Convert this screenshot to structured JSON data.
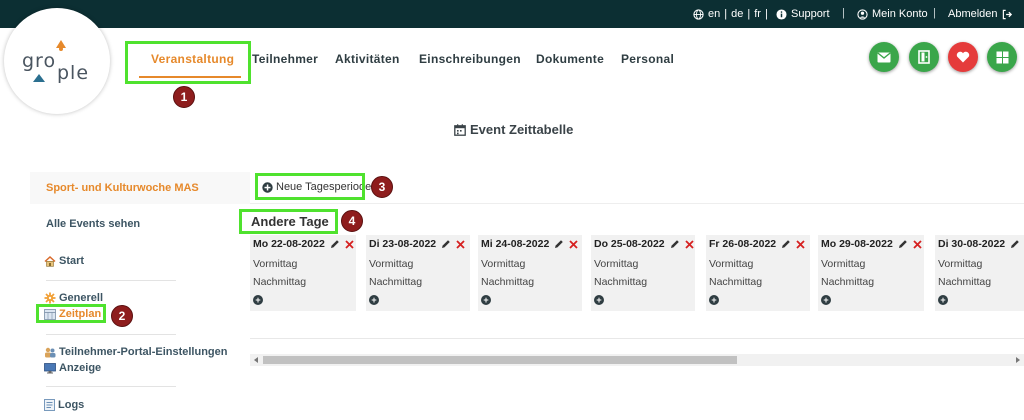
{
  "topbar": {
    "lang_en": "en",
    "lang_de": "de",
    "lang_fr": "fr",
    "support": "Support",
    "account": "Mein Konto",
    "logout": "Abmelden"
  },
  "logo": {
    "text1": "gro",
    "text2": "ple"
  },
  "nav": {
    "items": [
      "Veranstaltung",
      "Teilnehmer",
      "Aktivitäten",
      "Einschreibungen",
      "Dokumente",
      "Personal"
    ]
  },
  "actions": {
    "mail_color": "#3aa64a",
    "door_color": "#3aa64a",
    "heart_color": "#e53b3b",
    "grid_color": "#3aa64a"
  },
  "page": {
    "title": "Event Zeittabelle"
  },
  "sidebar": {
    "event_name": "Sport- und Kulturwoche MAS",
    "all_events": "Alle Events sehen",
    "start": "Start",
    "generell": "Generell",
    "zeitplan": "Zeitplan",
    "portal": "Teilnehmer-Portal-Einstellungen",
    "anzeige": "Anzeige",
    "logs": "Logs"
  },
  "timetable": {
    "add_period": "Neue Tagesperiode",
    "section": "Andere Tage",
    "days": [
      {
        "label": "Mo 22-08-2022",
        "slots": [
          "Vormittag",
          "Nachmittag"
        ]
      },
      {
        "label": "Di 23-08-2022",
        "slots": [
          "Vormittag",
          "Nachmittag"
        ]
      },
      {
        "label": "Mi 24-08-2022",
        "slots": [
          "Vormittag",
          "Nachmittag"
        ]
      },
      {
        "label": "Do 25-08-2022",
        "slots": [
          "Vormittag",
          "Nachmittag"
        ]
      },
      {
        "label": "Fr 26-08-2022",
        "slots": [
          "Vormittag",
          "Nachmittag"
        ]
      },
      {
        "label": "Mo 29-08-2022",
        "slots": [
          "Vormittag",
          "Nachmittag"
        ]
      },
      {
        "label": "Di 30-08-2022",
        "slots": [
          "Vormittag",
          "Nachmittag"
        ]
      }
    ]
  },
  "annotations": [
    "1",
    "2",
    "3",
    "4"
  ],
  "colors": {
    "accent": "#e6892b",
    "highlight": "#4fe22e",
    "badge": "#8e1d1d",
    "topbar": "#0c2f33"
  }
}
